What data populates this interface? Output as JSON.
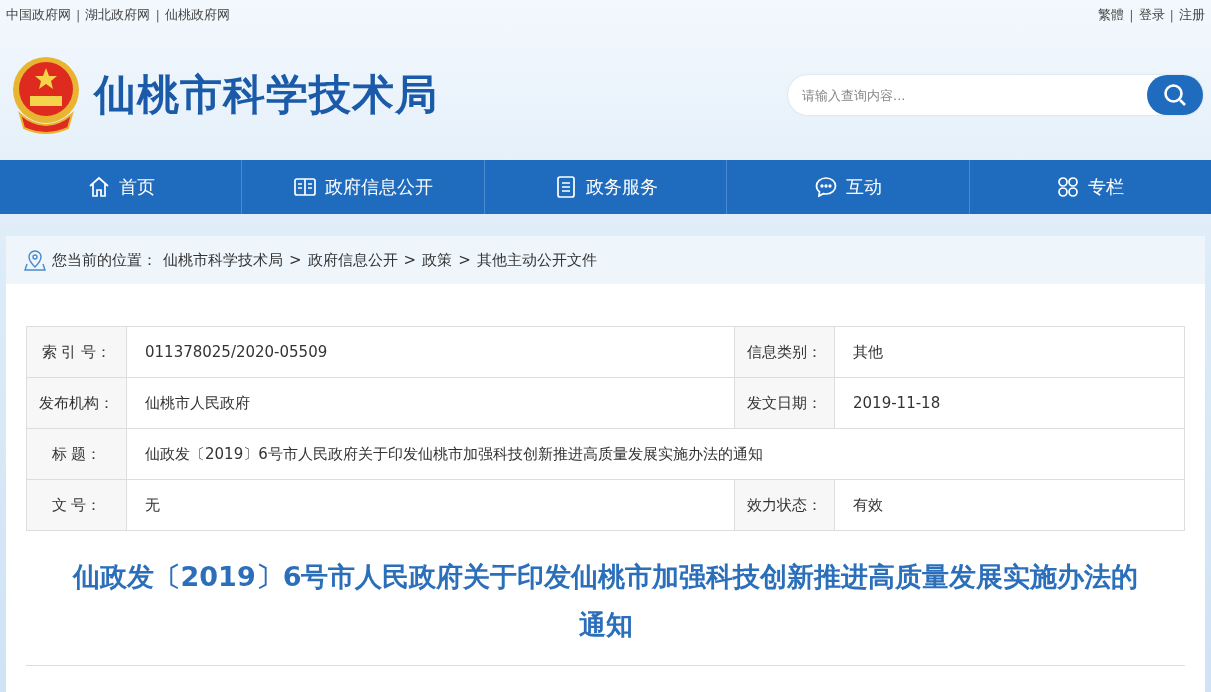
{
  "top_links": [
    "中国政府网",
    "湖北政府网",
    "仙桃政府网"
  ],
  "link_separator": "|",
  "user_links": [
    "繁體",
    "登录",
    "注册"
  ],
  "site_title": "仙桃市科学技术局",
  "search": {
    "placeholder": "请输入查询内容..."
  },
  "nav": [
    {
      "label": "首页",
      "kind": "home"
    },
    {
      "label": "政府信息公开",
      "kind": "book"
    },
    {
      "label": "政务服务",
      "kind": "doc"
    },
    {
      "label": "互动",
      "kind": "chat"
    },
    {
      "label": "专栏",
      "kind": "grid"
    }
  ],
  "breadcrumb": {
    "prefix": "您当前的位置：",
    "items": [
      "仙桃市科学技术局",
      "政府信息公开",
      "政策",
      "其他主动公开文件"
    ],
    "separator": ">"
  },
  "info_table": [
    [
      {
        "label": "索 引 号：",
        "value": "011378025/2020-05509"
      },
      {
        "label": "信息类别：",
        "value": "其他"
      }
    ],
    [
      {
        "label": "发布机构：",
        "value": "仙桃市人民政府"
      },
      {
        "label": "发文日期：",
        "value": "2019-11-18"
      }
    ],
    [
      {
        "label": "标 题：",
        "value": "仙政发〔2019〕6号市人民政府关于印发仙桃市加强科技创新推进高质量发展实施办法的通知"
      }
    ],
    [
      {
        "label": "文 号：",
        "value": "无"
      },
      {
        "label": "效力状态：",
        "value": "有效"
      }
    ]
  ],
  "article_title": "仙政发〔2019〕6号市人民政府关于印发仙桃市加强科技创新推进高质量发展实施办法的通知"
}
